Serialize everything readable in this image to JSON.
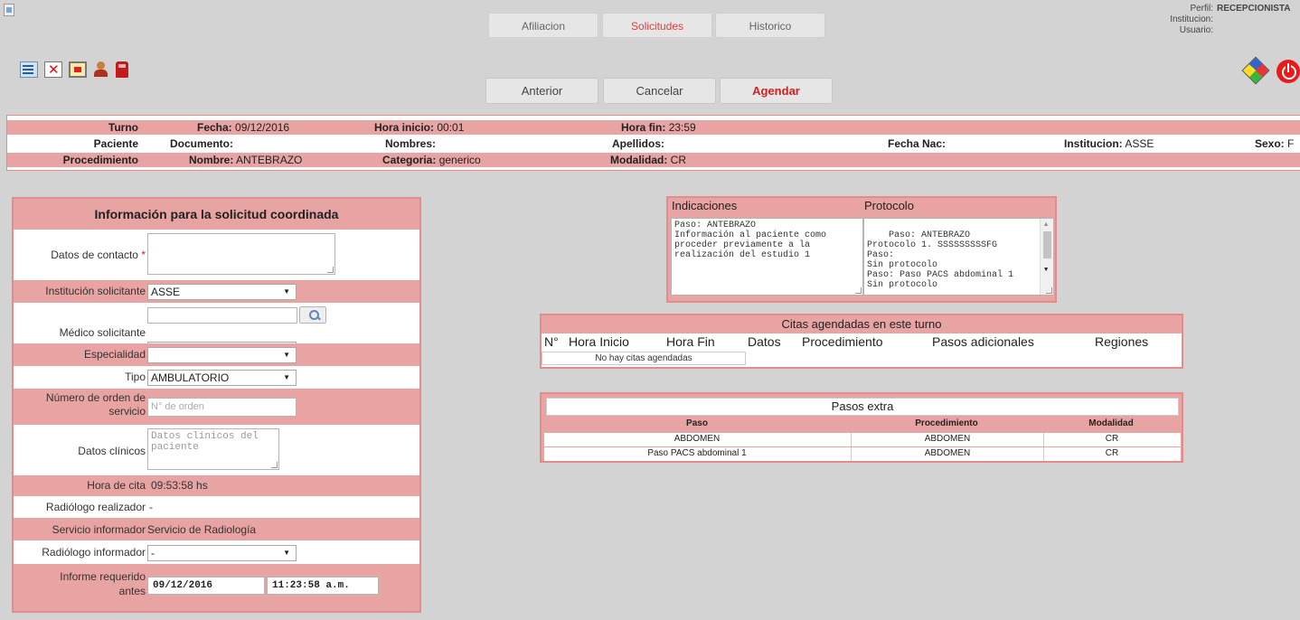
{
  "header": {
    "tabs": [
      {
        "label": "Afiliacion",
        "active": false
      },
      {
        "label": "Solicitudes",
        "active": true
      },
      {
        "label": "Historico",
        "active": false
      }
    ],
    "actions": {
      "anterior": "Anterior",
      "cancelar": "Cancelar",
      "agendar": "Agendar"
    },
    "perfil": {
      "perfil_label": "Perfil:",
      "perfil_value": "RECEPCIONISTA",
      "institucion_label": "Institucion:",
      "institucion_value": "",
      "usuario_label": "Usuario:",
      "usuario_value": ""
    },
    "toolbar_icons": [
      "list-edit-icon",
      "calendar-cancel-icon",
      "calendar-icon",
      "user-icon",
      "alarm-icon"
    ],
    "right_icons": [
      "cube-icon",
      "power-icon"
    ]
  },
  "info": {
    "turno": {
      "label": "Turno",
      "fecha_label": "Fecha:",
      "fecha": "09/12/2016",
      "hora_inicio_label": "Hora inicio:",
      "hora_inicio": "00:01",
      "hora_fin_label": "Hora fin:",
      "hora_fin": "23:59"
    },
    "paciente": {
      "label": "Paciente",
      "documento_label": "Documento:",
      "documento": "",
      "nombres_label": "Nombres:",
      "nombres": "",
      "apellidos_label": "Apellidos:",
      "apellidos": "",
      "fecha_nac_label": "Fecha Nac:",
      "fecha_nac": "",
      "institucion_label": "Institucion:",
      "institucion": "ASSE",
      "sexo_label": "Sexo:",
      "sexo": "F"
    },
    "procedimiento": {
      "label": "Procedimiento",
      "nombre_label": "Nombre:",
      "nombre": "ANTEBRAZO",
      "categoria_label": "Categoria:",
      "categoria": "generico",
      "modalidad_label": "Modalidad:",
      "modalidad": "CR"
    }
  },
  "form": {
    "title": "Información para la solicitud coordinada",
    "datos_contacto": {
      "label": "Datos de contacto",
      "required_mark": "*",
      "value": ""
    },
    "institucion_solicitante": {
      "label": "Institución solicitante",
      "value": "ASSE"
    },
    "medico_solicitante": {
      "label": "Médico solicitante",
      "search_value": "",
      "value": "-"
    },
    "especialidad": {
      "label": "Especialidad",
      "value": ""
    },
    "tipo": {
      "label": "Tipo",
      "value": "AMBULATORIO"
    },
    "numero_orden": {
      "label_line1": "Número de orden de",
      "label_line2": "servicio",
      "placeholder": "N° de orden"
    },
    "datos_clinicos": {
      "label": "Datos clínicos",
      "placeholder": "Datos clínicos del\npaciente"
    },
    "hora_cita": {
      "label": "Hora de cita",
      "value": "09:53:58 hs"
    },
    "radiologo_realizador": {
      "label": "Radiólogo realizador",
      "value": "-"
    },
    "servicio_informador": {
      "label": "Servicio informador",
      "value": "Servicio de Radiología"
    },
    "radiologo_informador": {
      "label": "Radiólogo informador",
      "value": "-"
    },
    "informe_requerido": {
      "label_line1": "Informe requerido",
      "label_line2": "antes",
      "date": "09/12/2016",
      "time": "11:23:58 a.m."
    }
  },
  "indicaciones": {
    "title": "Indicaciones",
    "text": "Paso: ANTEBRAZO\nInformación al paciente como\nproceder previamente a la\nrealización del estudio 1"
  },
  "protocolo": {
    "title": "Protocolo",
    "text": "Paso: ANTEBRAZO\nProtocolo 1. SSSSSSSSSFG\nPaso:\nSin protocolo\nPaso: Paso PACS abdominal 1\nSin protocolo"
  },
  "citas": {
    "title": "Citas agendadas en este turno",
    "columns": [
      "N°",
      "Hora Inicio",
      "Hora Fin",
      "Datos",
      "Procedimiento",
      "Pasos adicionales",
      "Regiones"
    ],
    "empty_text": "No hay citas agendadas"
  },
  "pasos_extra": {
    "title": "Pasos extra",
    "columns": [
      "Paso",
      "Procedimiento",
      "Modalidad"
    ],
    "rows": [
      [
        "ABDOMEN",
        "ABDOMEN",
        "CR"
      ],
      [
        "Paso PACS abdominal 1",
        "ABDOMEN",
        "CR"
      ]
    ]
  },
  "colors": {
    "accent_pink": "#e8a3a3",
    "border_pink": "#e48c8c",
    "active_tab": "#e53b3b",
    "background": "#d3d3d3"
  }
}
